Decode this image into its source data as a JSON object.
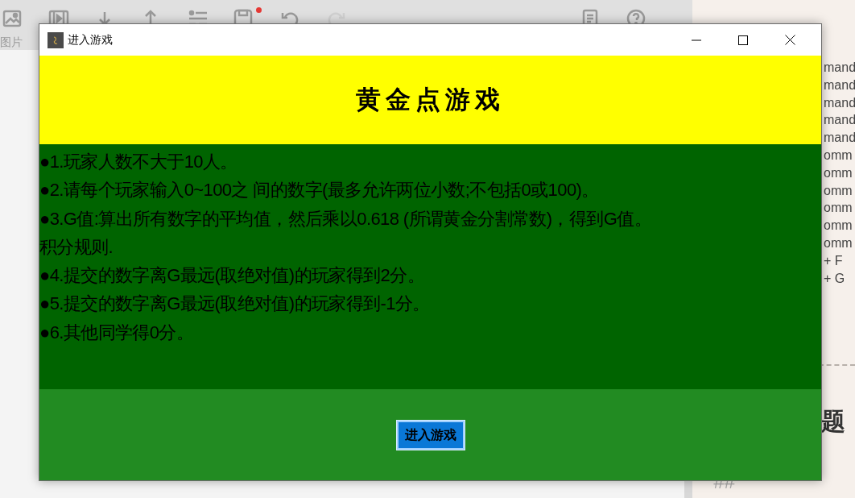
{
  "background_app": {
    "toolbar": {
      "image_label": "图片"
    },
    "help_panel": {
      "lines": [
        "mand",
        "mand",
        "mand",
        "mand",
        "mand",
        "omm",
        "omm",
        "omm",
        "omm",
        "omm",
        "omm",
        "+ F",
        "+ G"
      ],
      "heading_1": "题",
      "heading_2_marker": "##"
    }
  },
  "window": {
    "title": "进入游戏",
    "banner": "黄金点游戏",
    "rules": [
      "●1.玩家人数不大于10人。",
      "●2.请每个玩家输入0~100之 间的数字(最多允许两位小数;不包括0或100)。",
      "●3.G值:算出所有数字的平均值，然后乘以0.618 (所谓黄金分割常数)，得到G值。",
      "积分规则.",
      "●4.提交的数字离G最远(取绝对值)的玩家得到2分。",
      "●5.提交的数字离G最远(取绝对值)的玩家得到-1分。",
      "●6.其他同学得0分。"
    ],
    "button": "进入游戏"
  }
}
